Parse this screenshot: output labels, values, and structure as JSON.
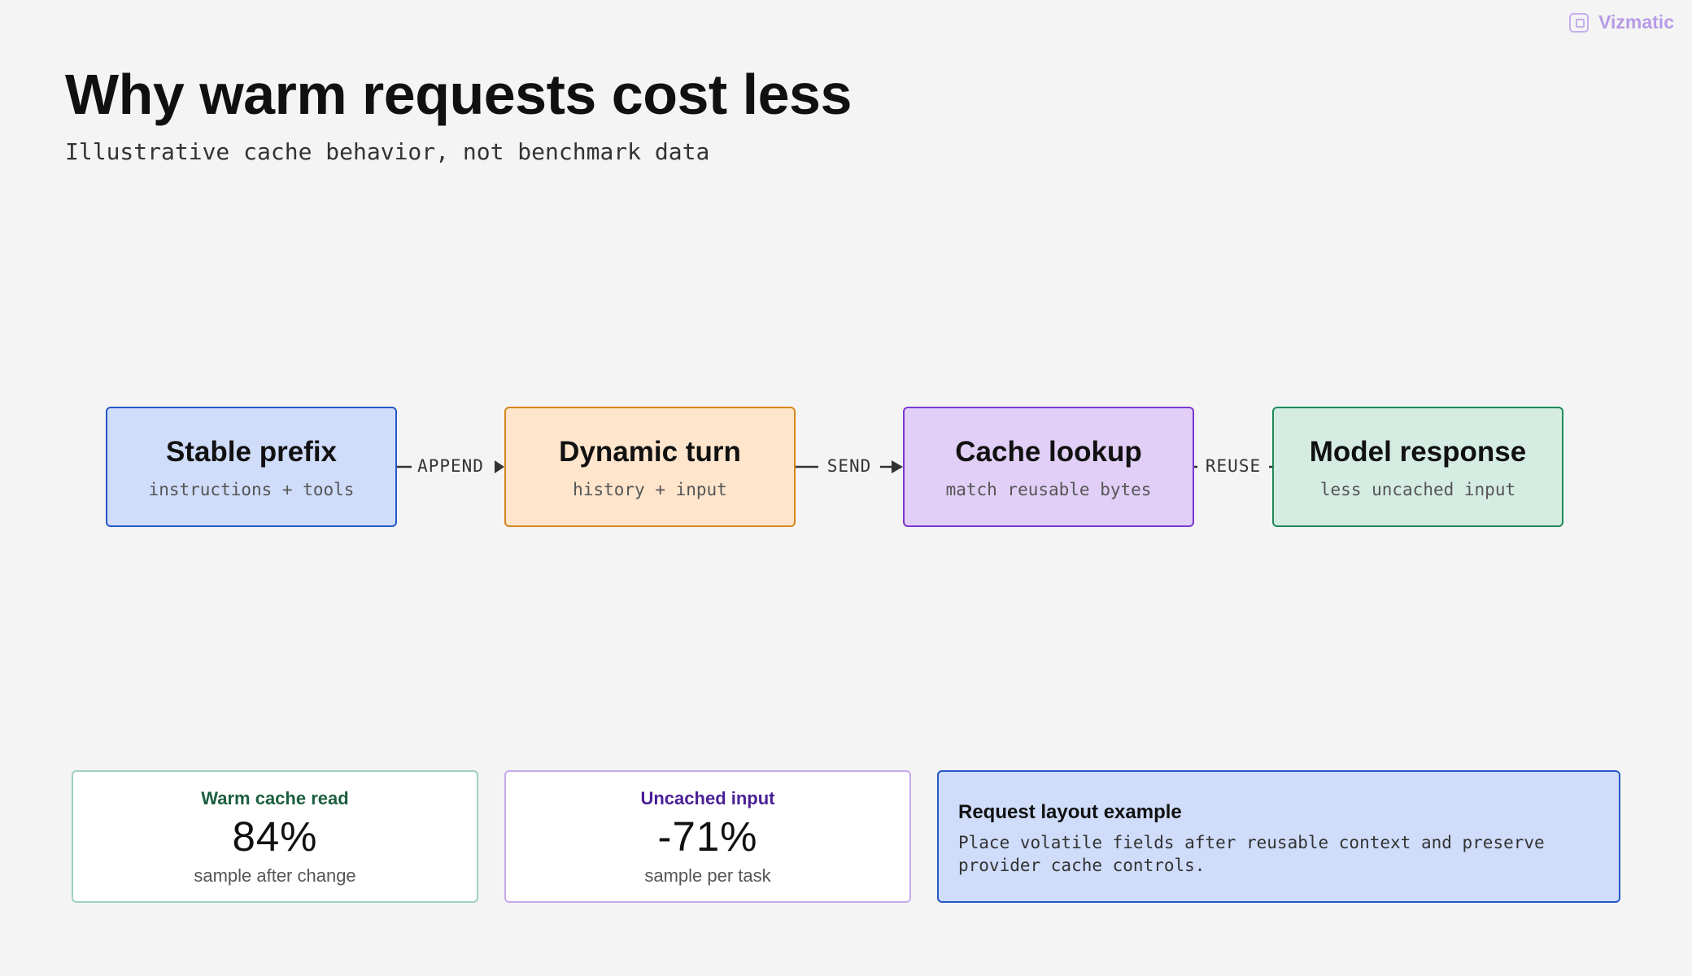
{
  "brand": {
    "name": "Vizmatic",
    "icon": "vizmatic-logo-icon",
    "color": "#b79ae6"
  },
  "header": {
    "title": "Why warm requests cost less",
    "subtitle": "Illustrative cache behavior, not benchmark data"
  },
  "flow": {
    "nodes": [
      {
        "title": "Stable prefix",
        "subtitle": "instructions + tools",
        "fill": "#cfdcfa",
        "stroke": "#2458c6"
      },
      {
        "title": "Dynamic turn",
        "subtitle": "history + input",
        "fill": "#fee5cc",
        "stroke": "#d7851c"
      },
      {
        "title": "Cache lookup",
        "subtitle": "match reusable bytes",
        "fill": "#e1cff7",
        "stroke": "#7a38d1"
      },
      {
        "title": "Model response",
        "subtitle": "less uncached input",
        "fill": "#d5ece2",
        "stroke": "#1f8a5a"
      }
    ],
    "edges": [
      {
        "label": "APPEND"
      },
      {
        "label": "SEND"
      },
      {
        "label": "REUSE"
      }
    ]
  },
  "metrics": [
    {
      "label": "Warm cache read",
      "value": "84%",
      "note": "sample after change",
      "color": "#1b5e3f"
    },
    {
      "label": "Uncached input",
      "value": "-71%",
      "note": "sample per task",
      "color": "#4a1f96"
    }
  ],
  "note": {
    "title": "Request layout example",
    "body": "Place volatile fields after reusable context and preserve provider cache controls."
  }
}
